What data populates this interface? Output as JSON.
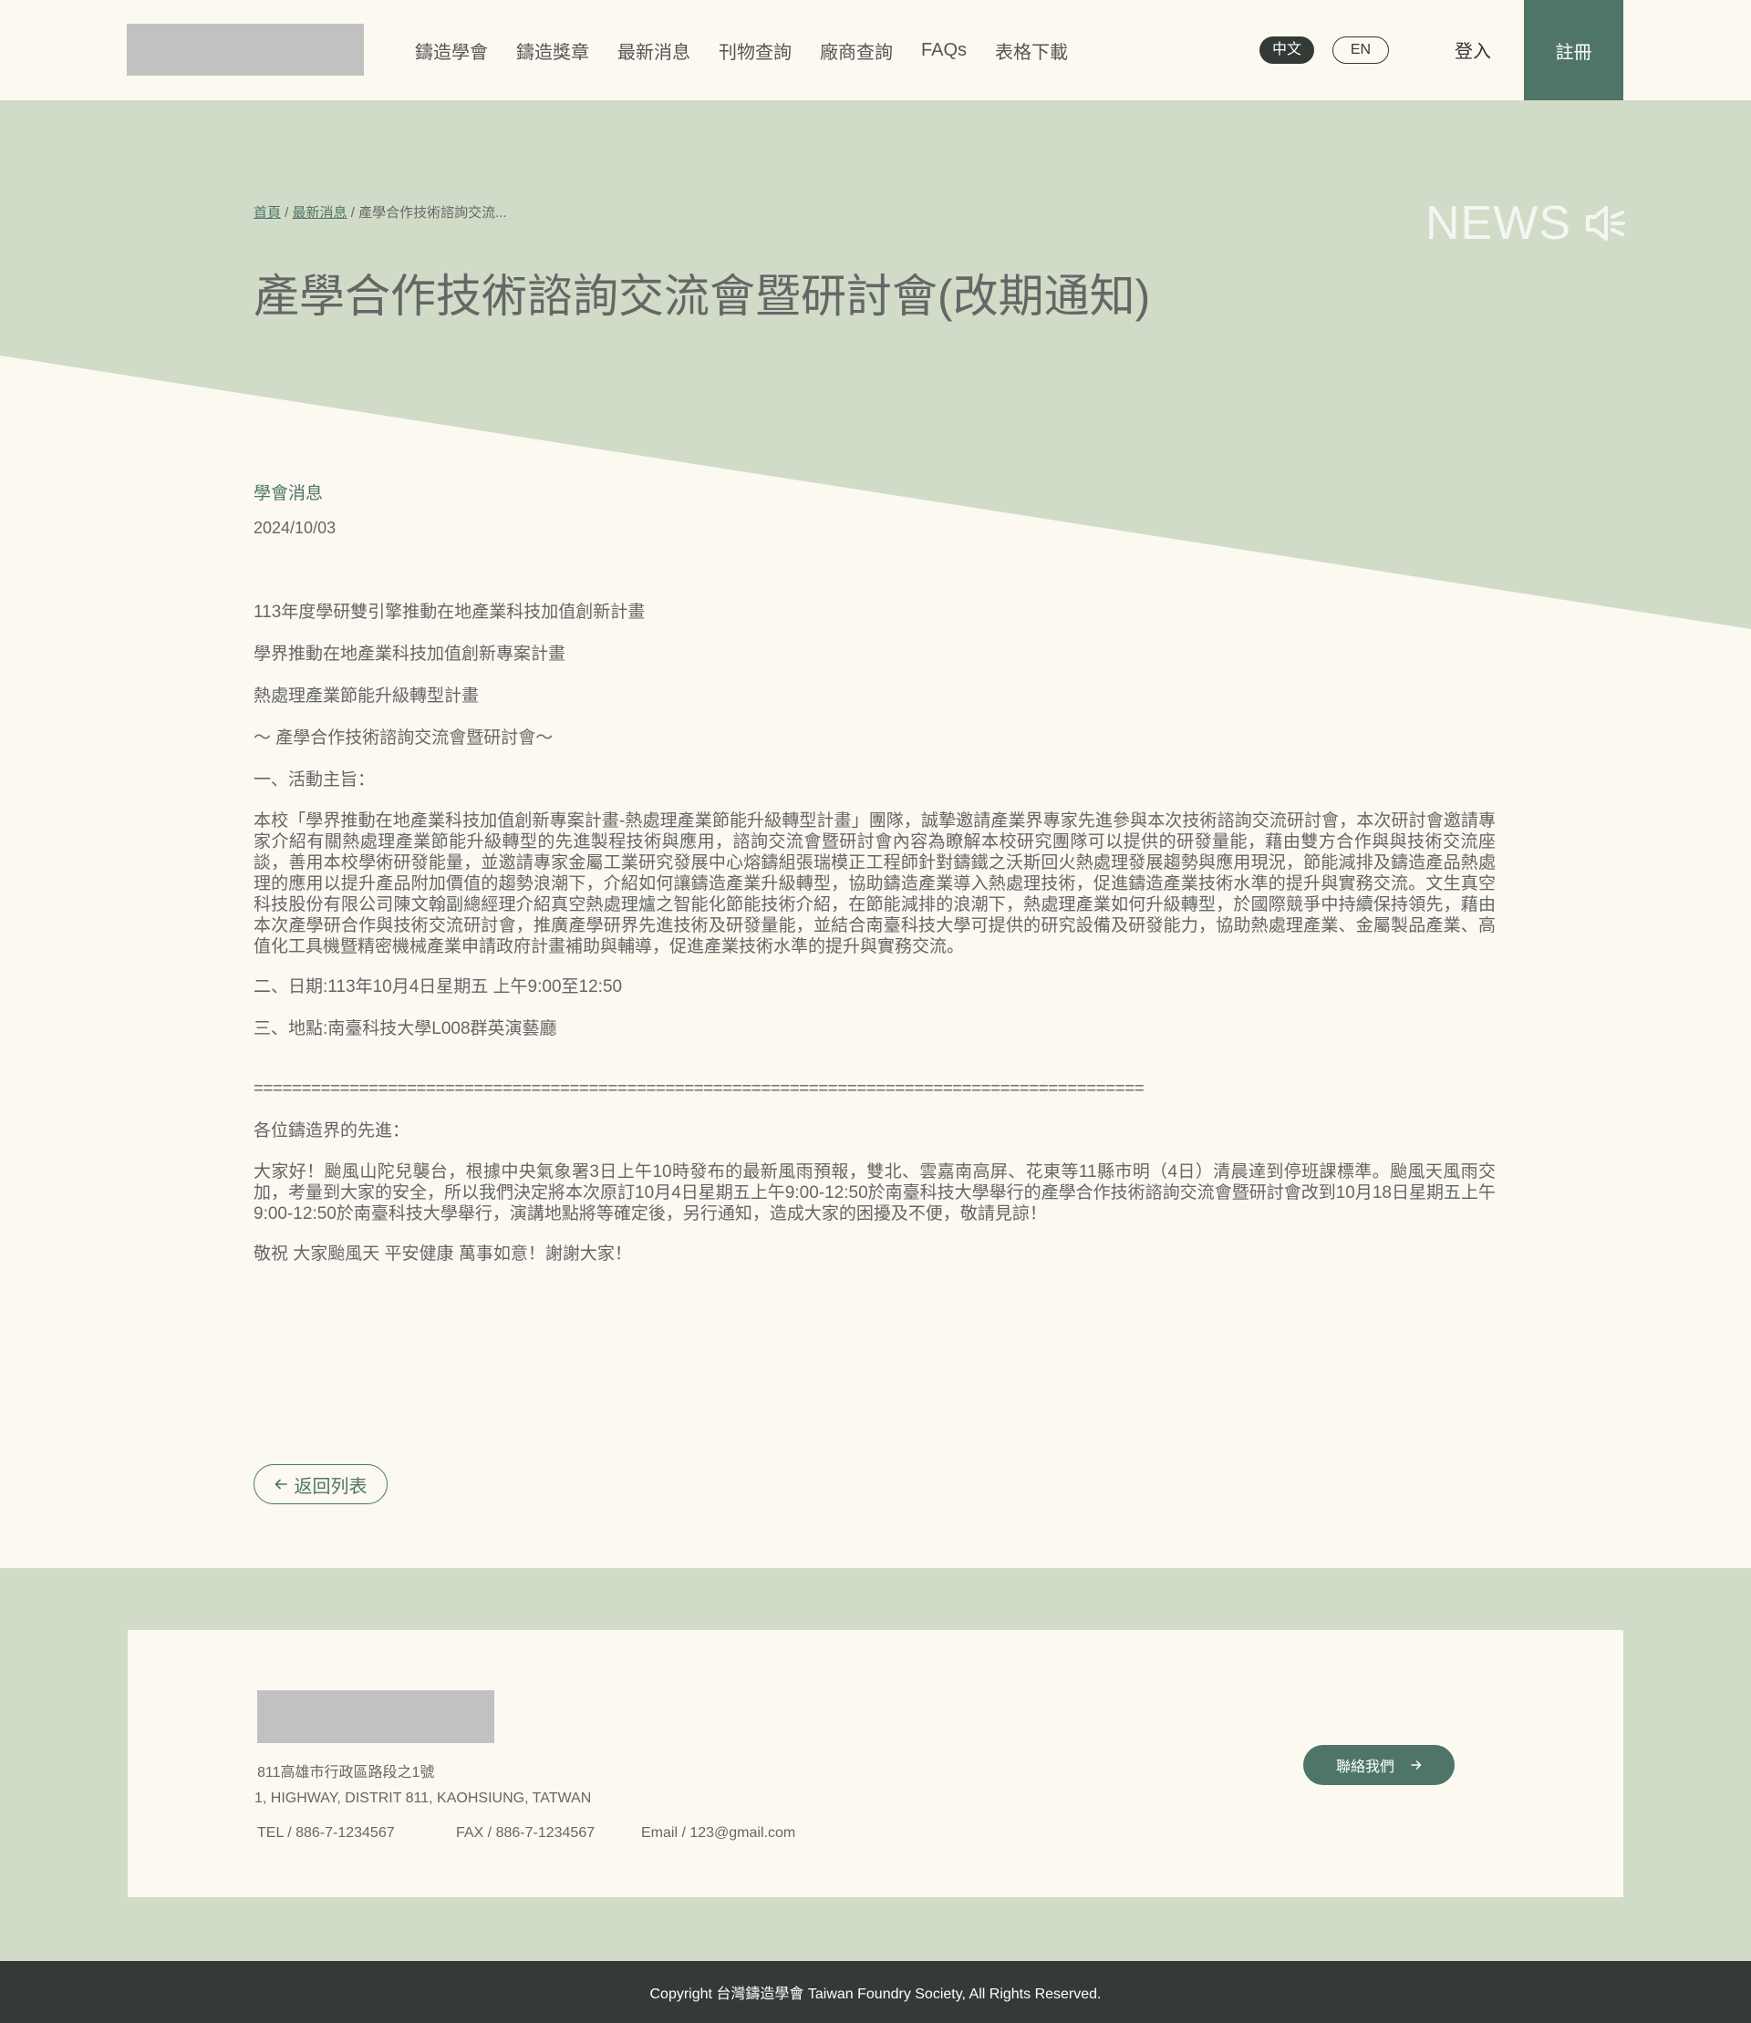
{
  "header": {
    "nav": [
      "鑄造學會",
      "鑄造獎章",
      "最新消息",
      "刊物查詢",
      "廠商查詢",
      "FAQs",
      "表格下載"
    ],
    "lang_zh": "中文",
    "lang_en": "EN",
    "login": "登入",
    "register": "註冊"
  },
  "breadcrumb": {
    "home": "首頁",
    "sep": " / ",
    "news": "最新消息",
    "current": "產學合作技術諮詢交流..."
  },
  "hero": {
    "watermark": "NEWS",
    "title": "產學合作技術諮詢交流會暨研討會(改期通知)"
  },
  "article": {
    "category": "學會消息",
    "date": "2024/10/03",
    "lines": [
      "113年度學研雙引擎推動在地產業科技加值創新計畫",
      "學界推動在地產業科技加值創新專案計畫",
      "熱處理產業節能升級轉型計畫",
      "～ 產學合作技術諮詢交流會暨研討會～",
      "一、活動主旨："
    ],
    "purpose": "本校「學界推動在地產業科技加值創新專案計畫-熱處理產業節能升級轉型計畫」團隊，誠摯邀請產業界專家先進參與本次技術諮詢交流研討會，本次研討會邀請專家介紹有關熱處理產業節能升級轉型的先進製程技術與應用，諮詢交流會暨研討會內容為瞭解本校研究團隊可以提供的研發量能，藉由雙方合作與與技術交流座談，善用本校學術研發能量，並邀請專家金屬工業研究發展中心熔鑄組張瑞模正工程師針對鑄鐵之沃斯回火熱處理發展趨勢與應用現況，節能減排及鑄造產品熱處理的應用以提升產品附加價值的趨勢浪潮下，介紹如何讓鑄造產業升級轉型，協助鑄造產業導入熱處理技術，促進鑄造產業技術水準的提升與實務交流。文生真空科技股份有限公司陳文翰副總經理介紹真空熱處理爐之智能化節能技術介紹，在節能減排的浪潮下，熱處理產業如何升級轉型，於國際競爭中持續保持領先，藉由本次產學研合作與技術交流研討會，推廣產學研界先進技術及研發量能，並結合南臺科技大學可提供的研究設備及研發能力，協助熱處理產業、金屬製品產業、高值化工具機暨精密機械產業申請政府計畫補助與輔導，促進產業技術水準的提升與實務交流。",
    "date_line": "二、日期:113年10月4日星期五 上午9:00至12:50",
    "place_line": "三、地點:南臺科技大學L008群英演藝廳",
    "divider": "=============================================================================================",
    "greeting": "各位鑄造界的先進：",
    "notice": "大家好！颱風山陀兒襲台，根據中央氣象署3日上午10時發布的最新風雨預報，雙北、雲嘉南高屏、花東等11縣市明（4日）清晨達到停班課標準。颱風天風雨交加，考量到大家的安全，所以我們決定將本次原訂10月4日星期五上午9:00-12:50於南臺科技大學舉行的產學合作技術諮詢交流會暨研討會改到10月18日星期五上午9:00-12:50於南臺科技大學舉行，演講地點將等確定後，另行通知，造成大家的困擾及不便，敬請見諒！",
    "closing": "敬祝 大家颱風天 平安健康 萬事如意！謝謝大家！",
    "back_label": "返回列表"
  },
  "footer": {
    "address_zh": "811高雄市行政區路段之1號",
    "address_en": "1, HIGHWAY, DISTRIT 811, KAOHSIUNG, TATWAN",
    "tel": "TEL / 886-7-1234567",
    "fax": "FAX / 886-7-1234567",
    "email": "Email / 123@gmail.com",
    "contact_label": "聯絡我們",
    "copyright": "Copyright 台灣鑄造學會 Taiwan Foundry Society, All Rights Reserved."
  },
  "colors": {
    "accent": "#4e7568",
    "band": "#d0dcc8",
    "background": "#fcf9f1",
    "dark": "#363a37"
  },
  "icons": [
    "speaker-mute-icon",
    "arrow-left-icon",
    "arrow-right-icon"
  ]
}
